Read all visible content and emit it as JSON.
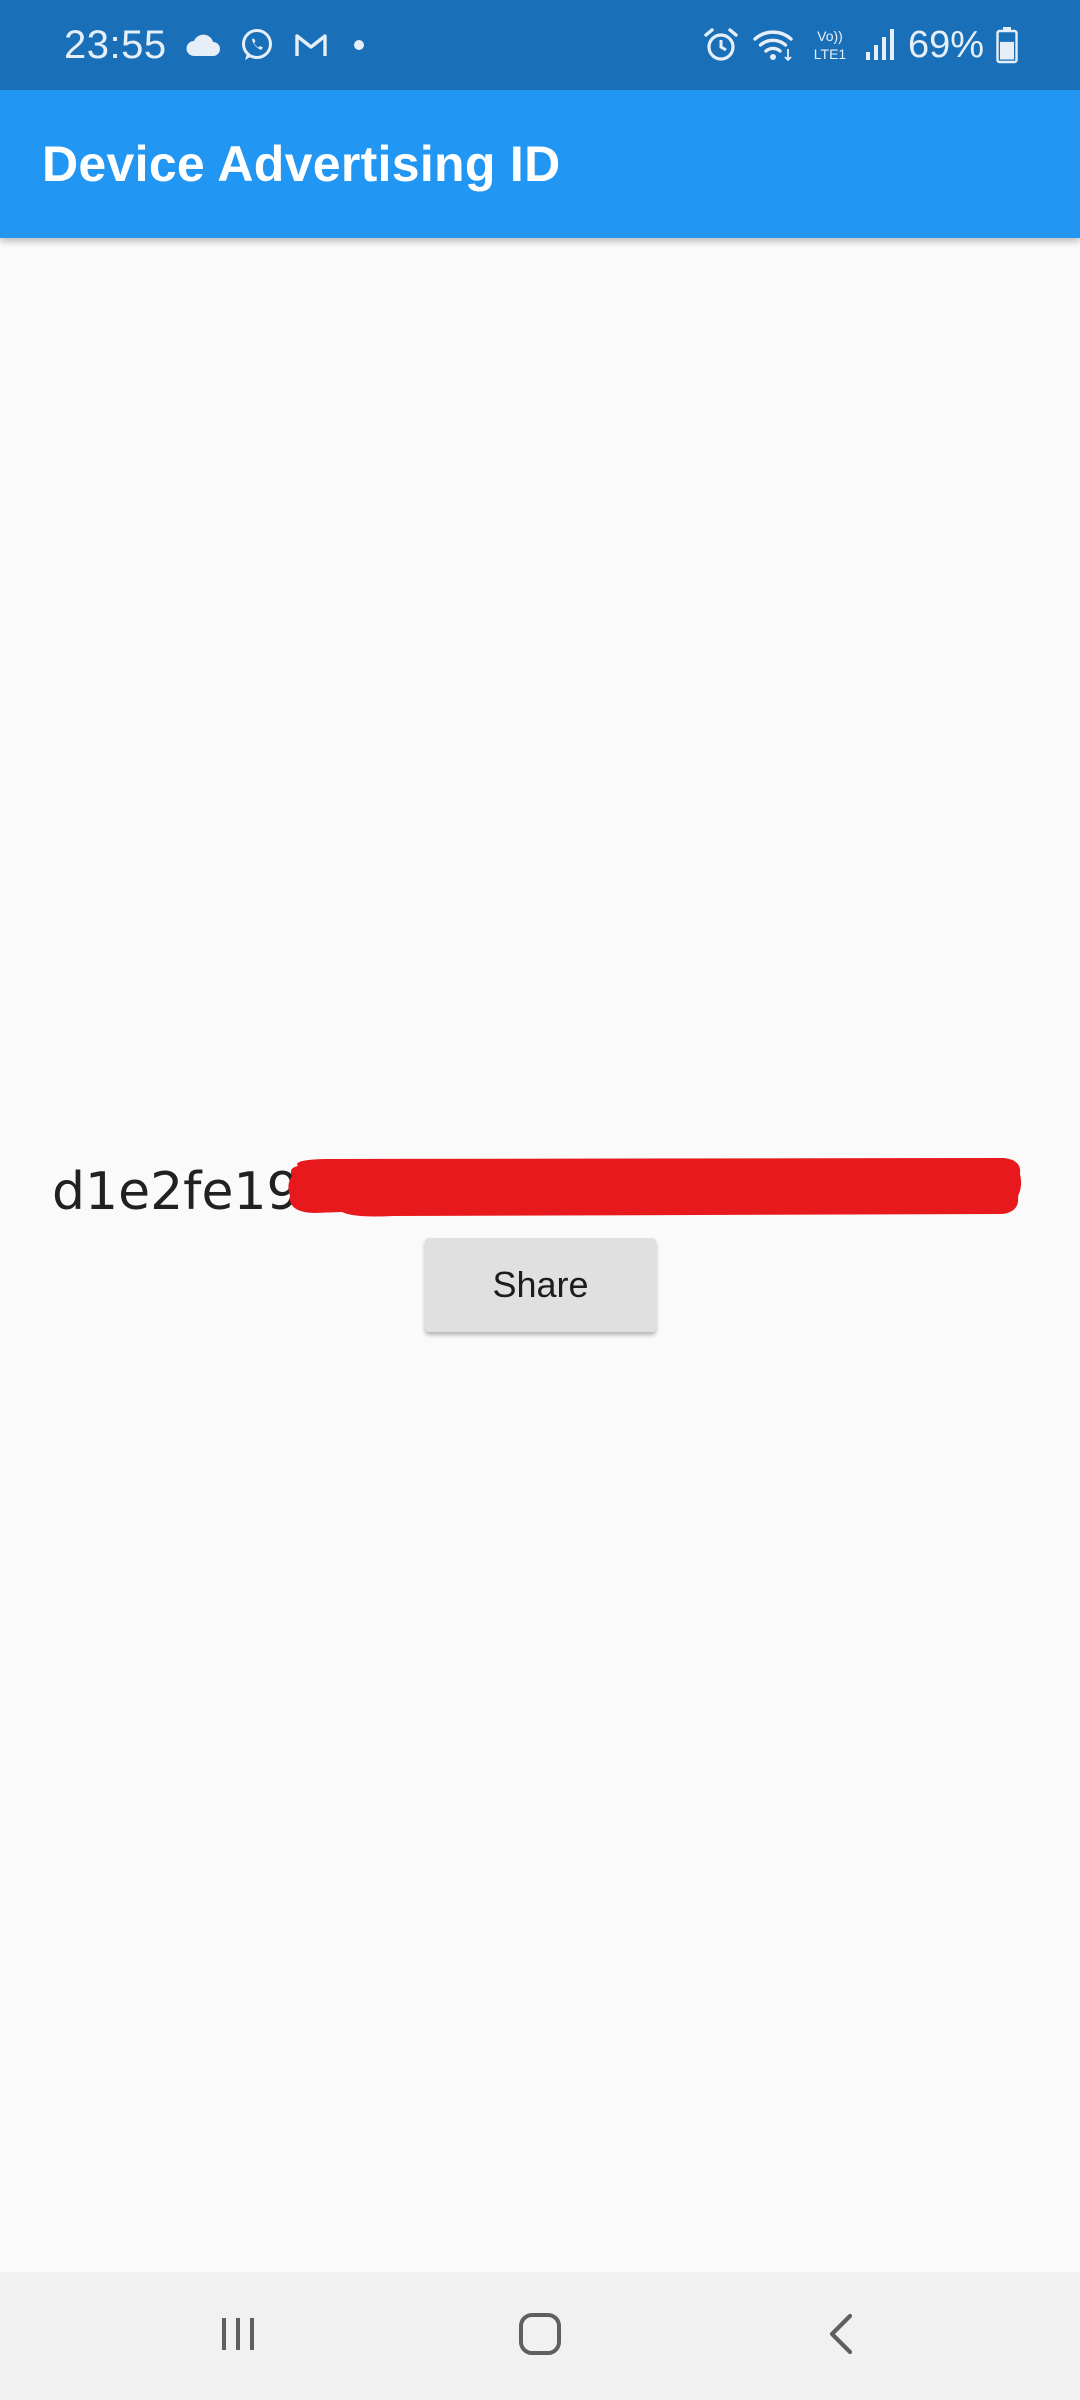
{
  "status_bar": {
    "time": "23:55",
    "battery_percent": "69%",
    "battery_level": 0.69,
    "left_icons": [
      "cloud-icon",
      "whatsapp-icon",
      "gmail-icon",
      "dot-icon"
    ],
    "right_icons": [
      "alarm-icon",
      "wifi-icon",
      "volte-icon",
      "signal-icon",
      "battery-icon"
    ],
    "volte_label_top": "Vo))",
    "volte_label_bottom": "LTE1",
    "background_color": "#1a70b8"
  },
  "app_bar": {
    "title": "Device Advertising ID",
    "background_color": "#2196f3"
  },
  "content": {
    "ad_id_visible": "d1e2fe19",
    "redaction_color": "#e8191d",
    "share_button_label": "Share"
  },
  "nav_bar": {
    "buttons": [
      "recent-apps-icon",
      "home-icon",
      "back-icon"
    ]
  }
}
